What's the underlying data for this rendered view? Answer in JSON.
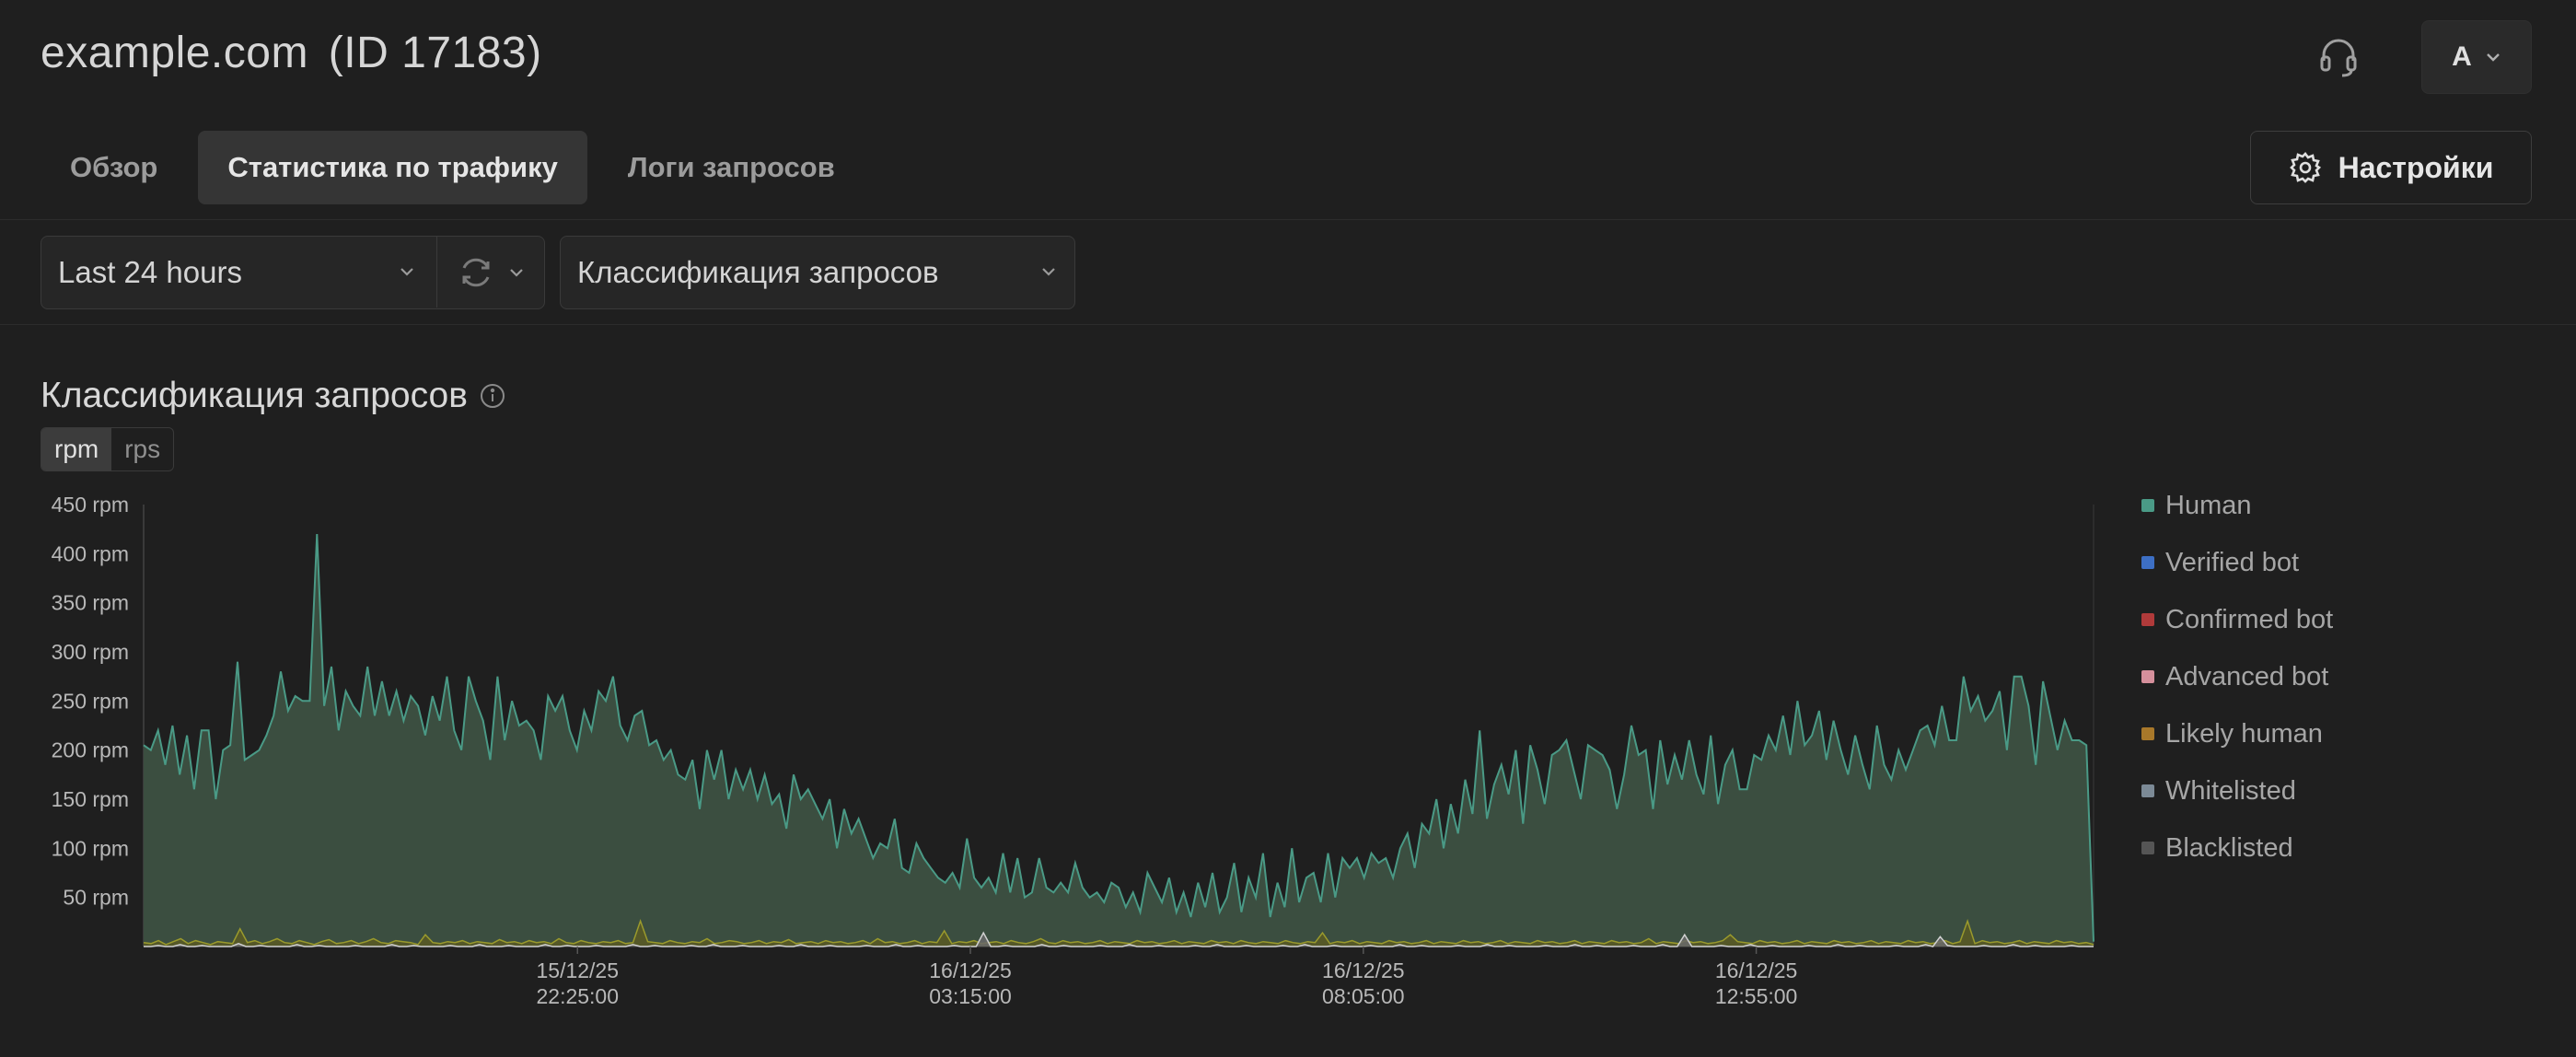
{
  "header": {
    "site_name": "example.com",
    "site_id": "(ID 17183)",
    "account_initial": "A"
  },
  "tabs": [
    {
      "label": "Обзор",
      "active": false
    },
    {
      "label": "Статистика по трафику",
      "active": true
    },
    {
      "label": "Логи запросов",
      "active": false
    }
  ],
  "settings_label": "Настройки",
  "filters": {
    "period": "Last 24 hours",
    "classification": "Классификация запросов"
  },
  "section": {
    "title": "Классификация запросов",
    "units": [
      {
        "label": "rpm",
        "active": true
      },
      {
        "label": "rps",
        "active": false
      }
    ]
  },
  "colors": {
    "human": "#4a9a86",
    "human_fill": "#3b4e40",
    "verified_bot": "#3d6fc4",
    "confirmed_bot": "#b03a3a",
    "advanced_bot": "#d6909c",
    "likely_human": "#a8782a",
    "whitelisted": "#7c8a96",
    "blacklisted": "#555555"
  },
  "chart_data": {
    "type": "area",
    "ylim": [
      0,
      450
    ],
    "y_ticks": [
      "50 rpm",
      "100 rpm",
      "150 rpm",
      "200 rpm",
      "250 rpm",
      "300 rpm",
      "350 rpm",
      "400 rpm",
      "450 rpm"
    ],
    "x_ticks": [
      {
        "date": "15/12/25",
        "time": "22:25:00"
      },
      {
        "date": "16/12/25",
        "time": "03:15:00"
      },
      {
        "date": "16/12/25",
        "time": "08:05:00"
      },
      {
        "date": "16/12/25",
        "time": "12:55:00"
      }
    ],
    "legend": [
      "Human",
      "Verified bot",
      "Confirmed bot",
      "Advanced bot",
      "Likely human",
      "Whitelisted",
      "Blacklisted"
    ],
    "series": [
      {
        "name": "Human",
        "values": [
          205,
          200,
          220,
          185,
          225,
          175,
          215,
          160,
          220,
          220,
          150,
          200,
          205,
          290,
          190,
          195,
          200,
          215,
          235,
          280,
          240,
          255,
          250,
          250,
          420,
          245,
          285,
          220,
          260,
          245,
          235,
          285,
          235,
          270,
          235,
          260,
          230,
          255,
          245,
          215,
          255,
          230,
          275,
          220,
          200,
          275,
          250,
          230,
          190,
          275,
          210,
          250,
          225,
          230,
          220,
          190,
          255,
          240,
          255,
          220,
          200,
          240,
          220,
          260,
          250,
          275,
          225,
          210,
          235,
          240,
          205,
          210,
          190,
          200,
          175,
          170,
          190,
          140,
          200,
          170,
          200,
          150,
          180,
          160,
          180,
          150,
          175,
          145,
          155,
          120,
          175,
          150,
          160,
          145,
          130,
          150,
          100,
          140,
          115,
          130,
          110,
          90,
          105,
          100,
          130,
          80,
          75,
          105,
          90,
          80,
          70,
          65,
          75,
          60,
          110,
          70,
          60,
          70,
          55,
          95,
          55,
          90,
          50,
          55,
          90,
          60,
          55,
          65,
          55,
          85,
          60,
          50,
          55,
          45,
          65,
          60,
          40,
          55,
          35,
          75,
          60,
          45,
          70,
          35,
          55,
          30,
          65,
          40,
          75,
          35,
          50,
          85,
          35,
          70,
          50,
          95,
          30,
          65,
          40,
          100,
          45,
          70,
          75,
          45,
          95,
          50,
          90,
          80,
          90,
          70,
          95,
          85,
          90,
          70,
          100,
          115,
          80,
          125,
          115,
          150,
          100,
          145,
          115,
          170,
          135,
          220,
          130,
          165,
          185,
          155,
          200,
          125,
          205,
          180,
          145,
          195,
          200,
          210,
          180,
          150,
          205,
          200,
          195,
          180,
          140,
          175,
          225,
          195,
          200,
          140,
          210,
          165,
          195,
          170,
          210,
          175,
          155,
          215,
          145,
          185,
          200,
          160,
          160,
          195,
          190,
          215,
          200,
          235,
          195,
          250,
          205,
          215,
          240,
          190,
          230,
          200,
          175,
          215,
          185,
          160,
          225,
          185,
          170,
          200,
          180,
          200,
          220,
          225,
          205,
          245,
          210,
          210,
          275,
          240,
          255,
          230,
          240,
          260,
          200,
          275,
          275,
          245,
          185,
          270,
          235,
          200,
          230,
          210,
          210,
          205,
          5
        ],
        "fill": "#3b4e40",
        "stroke": "#4a9a86"
      },
      {
        "name": "Likely human",
        "values": [
          4,
          3,
          6,
          2,
          5,
          8,
          3,
          6,
          4,
          2,
          5,
          4,
          3,
          18,
          4,
          6,
          3,
          5,
          8,
          4,
          3,
          6,
          4,
          2,
          5,
          7,
          3,
          4,
          6,
          3,
          5,
          8,
          4,
          3,
          6,
          5,
          4,
          2,
          12,
          4,
          3,
          5,
          4,
          6,
          3,
          5,
          4,
          3,
          7,
          4,
          5,
          3,
          6,
          4,
          5,
          3,
          8,
          4,
          3,
          6,
          4,
          3,
          5,
          4,
          6,
          3,
          4,
          26,
          5,
          4,
          3,
          6,
          4,
          3,
          5,
          4,
          8,
          3,
          4,
          6,
          5,
          3,
          4,
          6,
          3,
          5,
          4,
          7,
          3,
          4,
          5,
          3,
          6,
          4,
          5,
          3,
          4,
          6,
          3,
          8,
          4,
          5,
          3,
          4,
          6,
          3,
          5,
          4,
          16,
          3,
          5,
          4,
          6,
          3,
          4,
          5,
          3,
          6,
          4,
          3,
          5,
          8,
          4,
          3,
          6,
          4,
          5,
          3,
          4,
          6,
          3,
          5,
          4,
          3,
          6,
          4,
          5,
          3,
          4,
          6,
          3,
          5,
          4,
          3,
          6,
          4,
          5,
          3,
          6,
          4,
          3,
          5,
          4,
          3,
          6,
          4,
          3,
          5,
          4,
          14,
          3,
          5,
          4,
          6,
          3,
          5,
          4,
          3,
          6,
          4,
          5,
          3,
          4,
          6,
          3,
          5,
          4,
          3,
          6,
          4,
          5,
          3,
          4,
          6,
          3,
          5,
          4,
          3,
          6,
          4,
          5,
          3,
          4,
          6,
          3,
          5,
          4,
          3,
          6,
          4,
          5,
          3,
          4,
          8,
          3,
          5,
          4,
          3,
          6,
          4,
          5,
          3,
          4,
          6,
          12,
          5,
          4,
          3,
          6,
          4,
          5,
          3,
          4,
          6,
          3,
          5,
          4,
          3,
          6,
          4,
          5,
          3,
          4,
          6,
          3,
          5,
          4,
          3,
          6,
          4,
          5,
          3,
          4,
          6,
          3,
          5,
          26,
          3,
          6,
          4,
          5,
          3,
          4,
          6,
          3,
          5,
          4,
          3,
          6,
          4,
          5,
          3,
          4,
          2
        ],
        "fill": "#5b5b24",
        "stroke": "#9a9a2c"
      },
      {
        "name": "Advanced bot",
        "values": [
          0,
          0,
          1,
          0,
          0,
          2,
          0,
          0,
          1,
          0,
          0,
          0,
          0,
          3,
          0,
          0,
          1,
          0,
          0,
          0,
          0,
          2,
          0,
          0,
          1,
          0,
          0,
          0,
          0,
          1,
          0,
          0,
          0,
          0,
          2,
          0,
          0,
          1,
          0,
          0,
          0,
          0,
          1,
          0,
          0,
          0,
          2,
          0,
          0,
          0,
          1,
          0,
          0,
          0,
          0,
          2,
          0,
          0,
          1,
          0,
          0,
          0,
          1,
          0,
          0,
          0,
          0,
          2,
          0,
          0,
          1,
          0,
          0,
          0,
          0,
          1,
          0,
          0,
          2,
          0,
          0,
          0,
          1,
          0,
          0,
          0,
          0,
          1,
          0,
          0,
          2,
          0,
          0,
          0,
          1,
          0,
          0,
          0,
          0,
          1,
          0,
          0,
          0,
          2,
          0,
          0,
          1,
          0,
          0,
          0,
          0,
          1,
          0,
          0,
          0,
          14,
          0,
          0,
          1,
          0,
          0,
          0,
          0,
          2,
          0,
          0,
          1,
          0,
          0,
          0,
          0,
          1,
          0,
          0,
          0,
          2,
          0,
          0,
          0,
          1,
          0,
          0,
          0,
          0,
          1,
          0,
          0,
          2,
          0,
          0,
          0,
          1,
          0,
          0,
          0,
          0,
          1,
          0,
          0,
          2,
          0,
          0,
          0,
          1,
          0,
          0,
          0,
          0,
          1,
          0,
          0,
          0,
          2,
          0,
          0,
          1,
          0,
          0,
          0,
          0,
          1,
          0,
          0,
          0,
          2,
          0,
          0,
          1,
          0,
          0,
          0,
          0,
          1,
          0,
          0,
          0,
          2,
          0,
          0,
          1,
          0,
          0,
          0,
          0,
          1,
          0,
          0,
          0,
          2,
          0,
          0,
          12,
          0,
          0,
          0,
          0,
          1,
          0,
          0,
          0,
          2,
          0,
          0,
          1,
          0,
          0,
          0,
          0,
          1,
          0,
          0,
          0,
          2,
          0,
          0,
          1,
          0,
          0,
          0,
          0,
          1,
          0,
          0,
          0,
          2,
          0,
          10,
          1,
          0,
          0,
          0,
          0,
          1,
          0,
          0,
          0,
          2,
          0,
          0,
          1,
          0,
          0,
          0,
          0,
          1,
          0,
          0,
          0
        ],
        "fill": "#6a6a6a",
        "stroke": "#d0d0d0"
      }
    ]
  }
}
